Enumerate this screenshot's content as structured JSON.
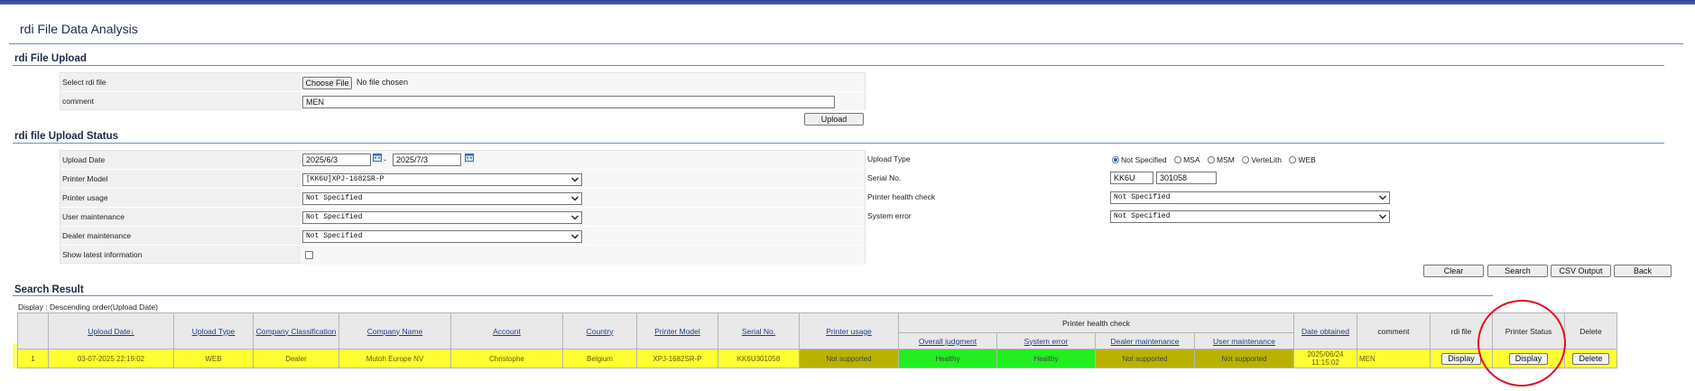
{
  "page_title": "rdi File Data Analysis",
  "upload_section": {
    "heading": "rdi File Upload",
    "select_label": "Select rdi file",
    "choose_button": "Choose File",
    "no_file_text": "No file chosen",
    "comment_label": "comment",
    "comment_value": "MEN",
    "upload_button": "Upload"
  },
  "status_section": {
    "heading": "rdi file Upload Status",
    "upload_date_label": "Upload Date",
    "date_from": "2025/6/3",
    "date_to": "2025/7/3",
    "printer_model_label": "Printer Model",
    "printer_model_value": "[KK6U]XPJ-1682SR-P",
    "printer_usage_label": "Printer usage",
    "printer_usage_value": "Not Specified",
    "user_maintenance_label": "User maintenance",
    "user_maintenance_value": "Not Specified",
    "dealer_maintenance_label": "Dealer maintenance",
    "dealer_maintenance_value": "Not Specified",
    "show_latest_label": "Show latest information",
    "upload_type_label": "Upload Type",
    "upload_type_options": [
      "Not Specified",
      "MSA",
      "MSM",
      "VerteLith",
      "WEB"
    ],
    "upload_type_selected": "Not Specified",
    "serial_label": "Serial No.",
    "serial_prefix": "KK6U",
    "serial_number": "301058",
    "health_check_label": "Printer health check",
    "health_check_value": "Not Specified",
    "system_error_label": "System error",
    "system_error_value": "Not Specified"
  },
  "actions": {
    "clear": "Clear",
    "search": "Search",
    "csv": "CSV Output",
    "back": "Back"
  },
  "results": {
    "heading": "Search Result",
    "display_note": "Display : Descending order(Upload Date)",
    "group_header": "Printer health check",
    "columns": {
      "upload_date": "Upload Date↓",
      "upload_type": "Upload Type",
      "company_class": "Company Classification",
      "company_name": "Company Name",
      "account": "Account",
      "country": "Country",
      "printer_model": "Printer Model",
      "serial": "Serial No.",
      "usage": "Printer usage",
      "overall": "Overall judgment",
      "system_error": "System error",
      "dealer_maint": "Dealer maintenance",
      "user_maint": "User maintenance",
      "date_obtained": "Date obtained",
      "comment": "comment",
      "rdi_file": "rdi file",
      "printer_status": "Printer Status",
      "delete": "Delete"
    },
    "row": {
      "no": "1",
      "upload_date": "03-07-2025 22:19:02",
      "upload_type": "WEB",
      "company_class": "Dealer",
      "company_name": "Mutoh Europe NV",
      "account": "Christophe",
      "country": "Belgium",
      "printer_model": "XPJ-1682SR-P",
      "serial": "KK6U301058",
      "usage": "Not supported",
      "overall": "Healthy",
      "system_error": "Healthy",
      "dealer_maint": "Not supported",
      "user_maint": "Not supported",
      "date_obtained_line1": "2025/06/24",
      "date_obtained_line2": "11:15:02",
      "comment": "MEN",
      "rdi_button": "Display",
      "status_button": "Display",
      "delete_button": "Delete"
    }
  },
  "colors": {
    "row_highlight": "#ffff33",
    "not_supported": "#b9b300",
    "healthy": "#22ee22",
    "annotation_circle": "#e01020"
  }
}
